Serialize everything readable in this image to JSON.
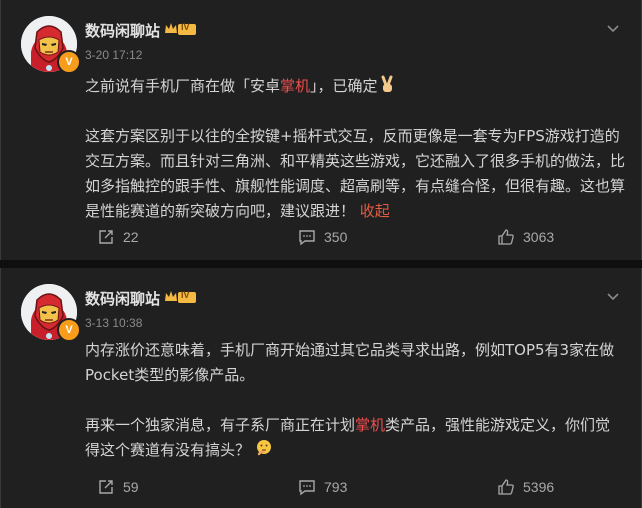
{
  "posts": [
    {
      "username": "数码闲聊站",
      "level": "IV",
      "verified_badge": "V",
      "time": "3-20 17:12",
      "line1_a": "之前说有手机厂商在做「安卓",
      "line1_hl": "掌机",
      "line1_b": "」，已确定",
      "emoji": "victory-hand",
      "para2_a": "这套方案区别于以往的全按键+摇杆式交互，反而更像是一套专为FPS游戏打造的交互方案。而且针对三角洲、和平精英这些游戏，它还融入了很多手机的做法，比如多指触控的跟手性、旗舰性能调度、超高刷等，有点缝合怪，但很有趣。这也算是性能赛道的新突破方向吧，建议跟进！",
      "collapse": "收起",
      "shares": "22",
      "comments": "350",
      "likes": "3063"
    },
    {
      "username": "数码闲聊站",
      "level": "IV",
      "verified_badge": "V",
      "time": "3-13 10:38",
      "para1": "内存涨价还意味着，手机厂商开始通过其它品类寻求出路，例如TOP5有3家在做Pocket类型的影像产品。",
      "para2_a": "再来一个独家消息，有子系厂商正在计划",
      "para2_hl": "掌机",
      "para2_b": "类产品，强性能游戏定义，你们觉得这个赛道有没有搞头？",
      "emoji": "thinking-face",
      "shares": "59",
      "comments": "793",
      "likes": "5396"
    }
  ],
  "colors": {
    "background": "#0f0f0f",
    "card": "#202020",
    "highlight": "#ee4e4e",
    "badge": "#f79d1b"
  }
}
